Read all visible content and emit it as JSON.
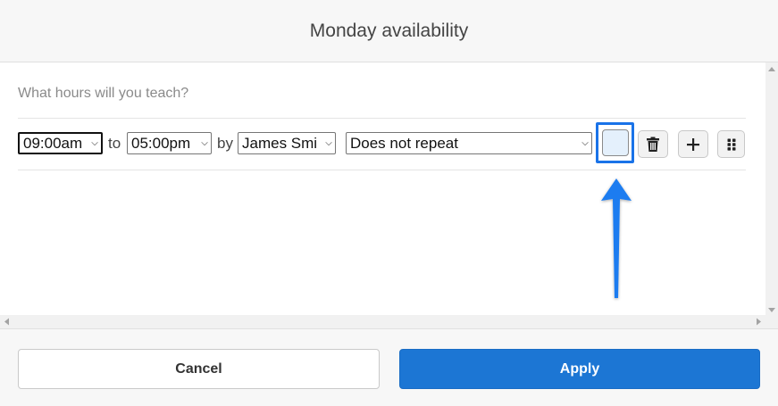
{
  "dialog": {
    "title": "Monday availability",
    "question": "What hours will you teach?"
  },
  "row": {
    "start_time": "09:00am",
    "to_label": "to",
    "end_time": "05:00pm",
    "by_label": "by",
    "teacher": "James Smi",
    "repeat": "Does not repeat",
    "color_value": "#e4f0fc"
  },
  "icons": {
    "delete": "trash-icon",
    "add": "plus-icon",
    "drag": "drag-handle-icon"
  },
  "footer": {
    "cancel_label": "Cancel",
    "apply_label": "Apply"
  },
  "colors": {
    "accent": "#1c76d4",
    "highlight": "#1a73e8",
    "swatch": "#e4f0fc"
  }
}
